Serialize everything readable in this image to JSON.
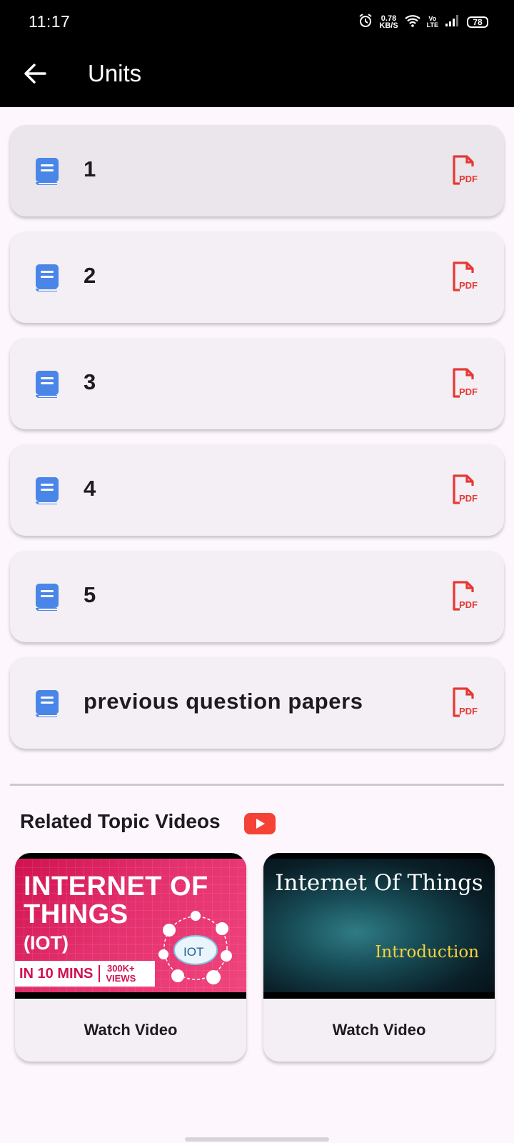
{
  "status_bar": {
    "time": "11:17",
    "net_speed_value": "0.78",
    "net_speed_unit": "KB/S",
    "volte_top": "Vo",
    "volte_bottom": "LTE",
    "battery": "78"
  },
  "app_bar": {
    "title": "Units",
    "back_icon": "arrow-back-icon"
  },
  "units": [
    {
      "label": "1",
      "icon": "book-icon",
      "action_icon": "pdf-icon",
      "pdf_text": "PDF"
    },
    {
      "label": "2",
      "icon": "book-icon",
      "action_icon": "pdf-icon",
      "pdf_text": "PDF"
    },
    {
      "label": "3",
      "icon": "book-icon",
      "action_icon": "pdf-icon",
      "pdf_text": "PDF"
    },
    {
      "label": "4",
      "icon": "book-icon",
      "action_icon": "pdf-icon",
      "pdf_text": "PDF"
    },
    {
      "label": "5",
      "icon": "book-icon",
      "action_icon": "pdf-icon",
      "pdf_text": "PDF"
    },
    {
      "label": "previous question papers",
      "icon": "book-icon",
      "action_icon": "pdf-icon",
      "pdf_text": "PDF"
    }
  ],
  "related": {
    "title": "Related Topic Videos",
    "icon": "youtube-icon",
    "videos": [
      {
        "thumb_line1": "INTERNET OF",
        "thumb_line2": "THINGS",
        "thumb_line3": "(IOT)",
        "thumb_strip": "IN 10 MINS",
        "thumb_views_top": "300K+",
        "thumb_views_bottom": "VIEWS",
        "thumb_badge": "IOT",
        "button": "Watch Video"
      },
      {
        "thumb_line1": "Internet Of Things",
        "thumb_line2": "Introduction",
        "button": "Watch Video"
      }
    ]
  },
  "colors": {
    "app_bar": "#000000",
    "background": "#fdf7fd",
    "card": "#f4eff4",
    "book_icon": "#4a86e8",
    "pdf_icon": "#e53935",
    "youtube": "#f44336"
  }
}
